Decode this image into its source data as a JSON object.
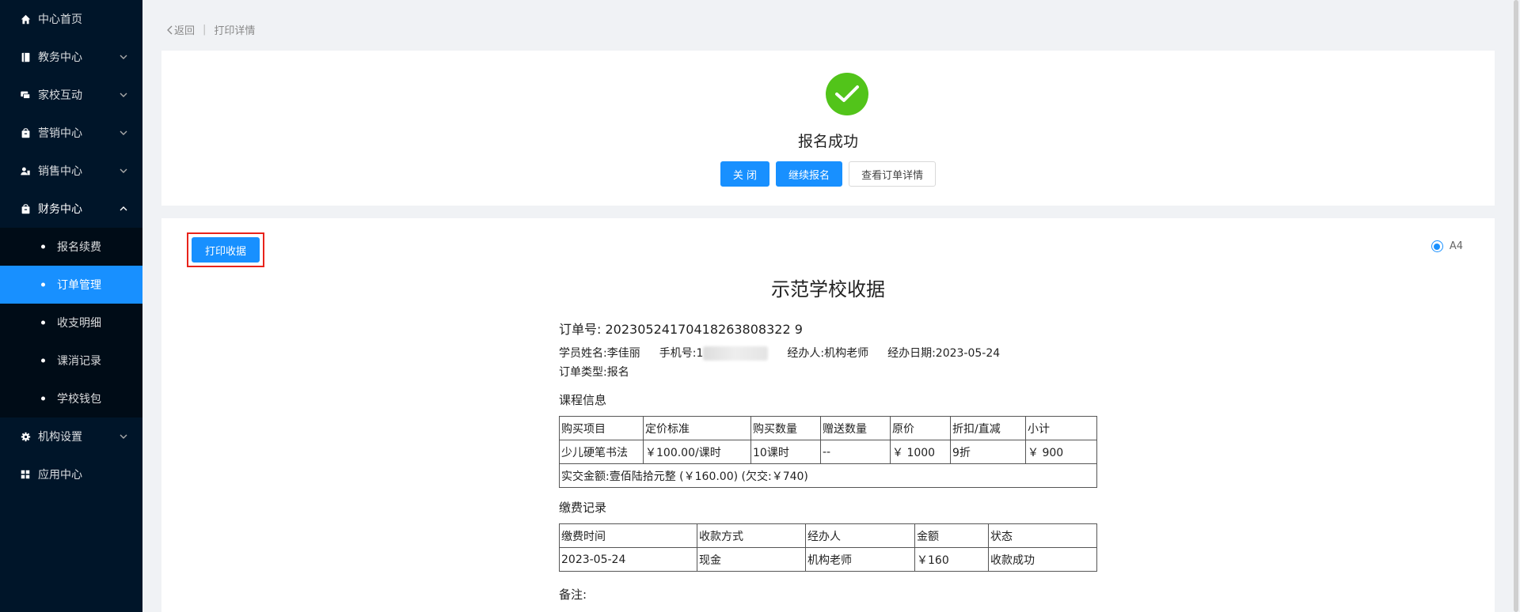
{
  "sidebar": {
    "items": [
      {
        "label": "中心首页",
        "icon": "home-icon"
      },
      {
        "label": "教务中心",
        "icon": "book-icon"
      },
      {
        "label": "家校互动",
        "icon": "chat-icon"
      },
      {
        "label": "营销中心",
        "icon": "bag-icon"
      },
      {
        "label": "销售中心",
        "icon": "users-icon"
      },
      {
        "label": "财务中心",
        "icon": "wallet-icon"
      },
      {
        "label": "机构设置",
        "icon": "gear-icon"
      },
      {
        "label": "应用中心",
        "icon": "grid-icon"
      }
    ],
    "finance_sub": [
      "报名续费",
      "订单管理",
      "收支明细",
      "课消记录",
      "学校钱包"
    ],
    "active_sub": "订单管理"
  },
  "breadcrumb": {
    "back": "返回",
    "current": "打印详情"
  },
  "success": {
    "title": "报名成功",
    "close": "关 闭",
    "continue": "继续报名",
    "view_order": "查看订单详情"
  },
  "receipt": {
    "print_button": "打印收据",
    "paper_option": "A4",
    "title": "示范学校收据",
    "order_no_label": "订单号:",
    "order_no": "20230524170418263808322 9",
    "student_label": "学员姓名:",
    "student": "李佳丽",
    "phone_label": "手机号:",
    "phone": "1",
    "handler_label": "经办人:",
    "handler": "机构老师",
    "date_label": "经办日期:",
    "date": "2023-05-24",
    "type_label": "订单类型:",
    "type": "报名",
    "course_section": "课程信息",
    "course_headers": [
      "购买项目",
      "定价标准",
      "购买数量",
      "赠送数量",
      "原价",
      "折扣/直减",
      "小计"
    ],
    "course_row": [
      "少儿硬笔书法",
      "￥100.00/课时",
      "10课时",
      "--",
      "￥ 1000",
      "9折",
      "￥ 900"
    ],
    "total_line": "实交金额:壹佰陆拾元整 (￥160.00) (欠交:￥740)",
    "payment_section": "缴费记录",
    "payment_headers": [
      "缴费时间",
      "收款方式",
      "经办人",
      "金额",
      "状态"
    ],
    "payment_row": [
      "2023-05-24",
      "现金",
      "机构老师",
      "￥160",
      "收款成功"
    ],
    "remark": "备注:"
  }
}
